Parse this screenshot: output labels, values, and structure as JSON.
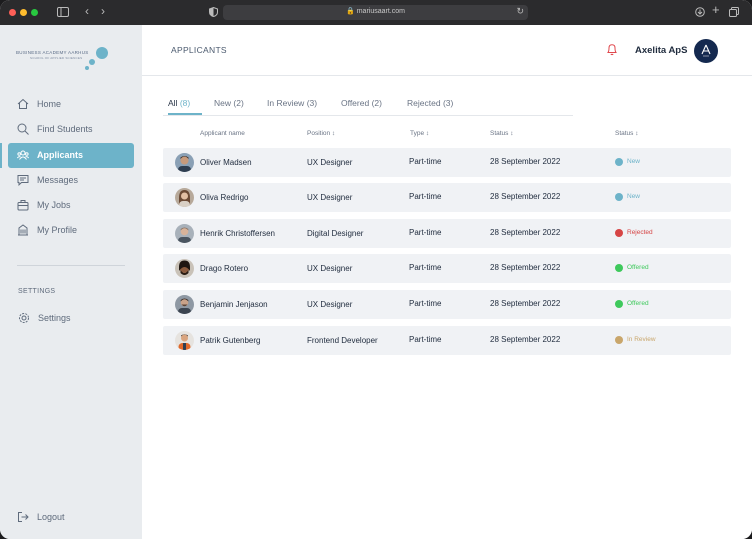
{
  "browser": {
    "url": "mariusaart.com"
  },
  "sidebar": {
    "logo_line1": "BUSINESS ACADEMY AARHUS",
    "logo_line2": "SCHOOL OF APPLIED SCIENCES",
    "items": [
      {
        "label": "Home",
        "icon": "home-icon"
      },
      {
        "label": "Find Students",
        "icon": "search-icon"
      },
      {
        "label": "Applicants",
        "icon": "users-icon"
      },
      {
        "label": "Messages",
        "icon": "message-icon"
      },
      {
        "label": "My Jobs",
        "icon": "briefcase-icon"
      },
      {
        "label": "My Profile",
        "icon": "building-icon"
      }
    ],
    "settings_section": "SETTINGS",
    "settings_item": "Settings",
    "logout": "Logout"
  },
  "header": {
    "title": "APPLICANTS",
    "company": "Axelita ApS"
  },
  "tabs": [
    {
      "label": "All",
      "count": "(8)"
    },
    {
      "label": "New",
      "count": "(2)"
    },
    {
      "label": "In Review",
      "count": "(3)"
    },
    {
      "label": "Offered",
      "count": "(2)"
    },
    {
      "label": "Rejected",
      "count": "(3)"
    }
  ],
  "table": {
    "columns": [
      "Applicant name",
      "Position ↕",
      "Type ↕",
      "Status ↕",
      "Status ↕"
    ],
    "rows": [
      {
        "name": "Oliver Madsen",
        "position": "UX Designer",
        "type": "Part-time",
        "date": "28 September 2022",
        "status": "New"
      },
      {
        "name": "Oliva Redrigo",
        "position": "UX Designer",
        "type": "Part-time",
        "date": "28 September 2022",
        "status": "New"
      },
      {
        "name": "Henrik Christoffersen",
        "position": "Digital Designer",
        "type": "Part-time",
        "date": "28 September 2022",
        "status": "Rejected"
      },
      {
        "name": "Drago Rotero",
        "position": "UX Designer",
        "type": "Part-time",
        "date": "28 September 2022",
        "status": "Offered"
      },
      {
        "name": "Benjamin Jenjason",
        "position": "UX Designer",
        "type": "Part-time",
        "date": "28 September 2022",
        "status": "Offered"
      },
      {
        "name": "Patrik Gutenberg",
        "position": "Frontend Developer",
        "type": "Part-time",
        "date": "28 September 2022",
        "status": "In Review"
      }
    ]
  },
  "colors": {
    "accent": "#6db3c9",
    "status_new": "#6db3c9",
    "status_rejected": "#d64545",
    "status_offered": "#3ec95c",
    "status_in_review": "#c9a66b"
  }
}
